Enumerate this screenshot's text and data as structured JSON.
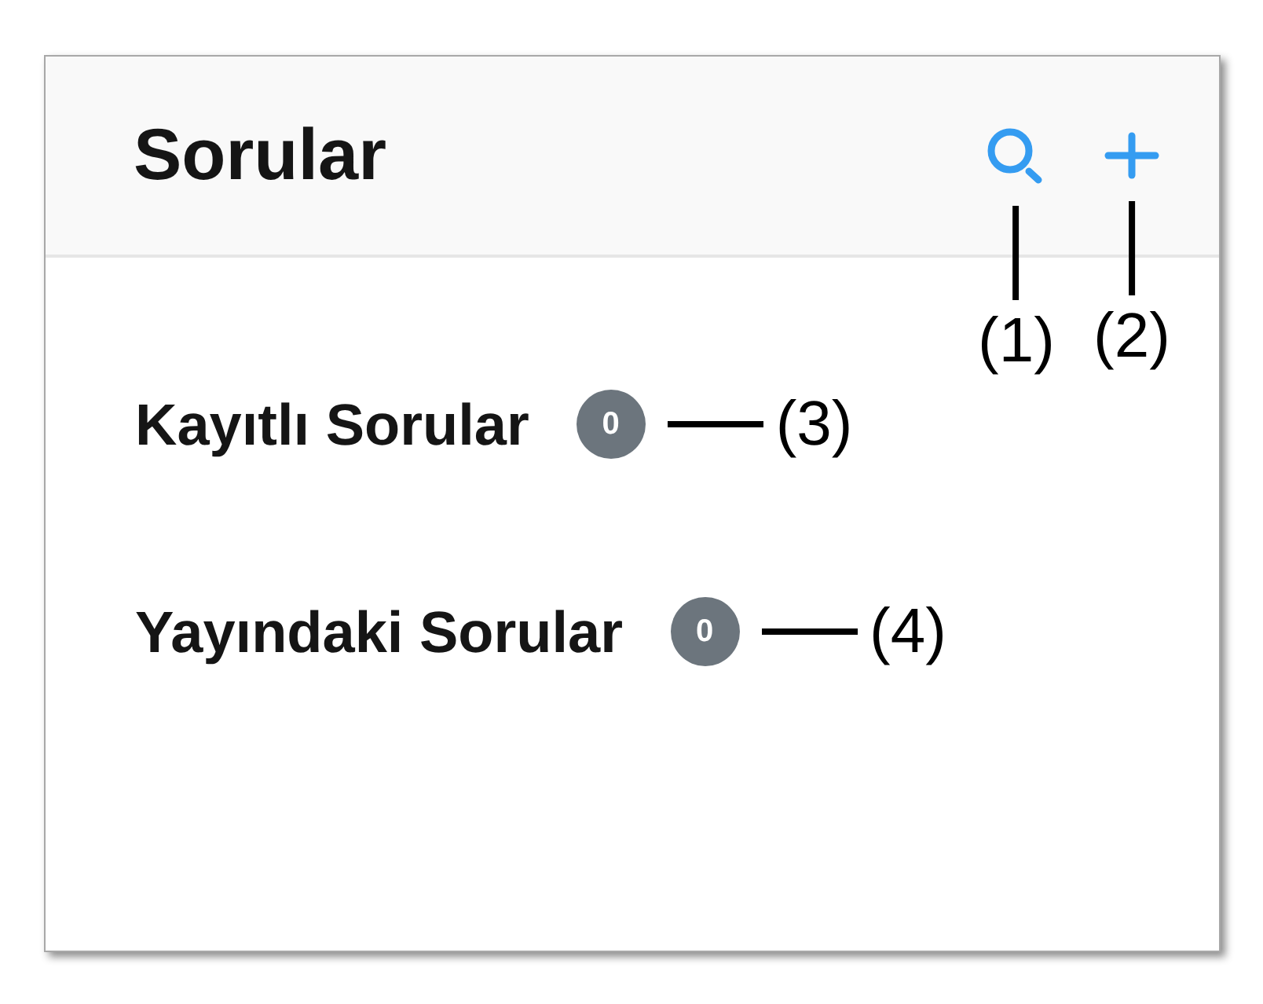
{
  "header": {
    "title": "Sorular",
    "actions": [
      {
        "kind": "search",
        "callout": "(1)"
      },
      {
        "kind": "add",
        "callout": "(2)"
      }
    ]
  },
  "items": [
    {
      "label": "Kayıtlı Sorular",
      "count": "0",
      "callout": "(3)"
    },
    {
      "label": "Yayındaki Sorular",
      "count": "0",
      "callout": "(4)"
    }
  ]
}
